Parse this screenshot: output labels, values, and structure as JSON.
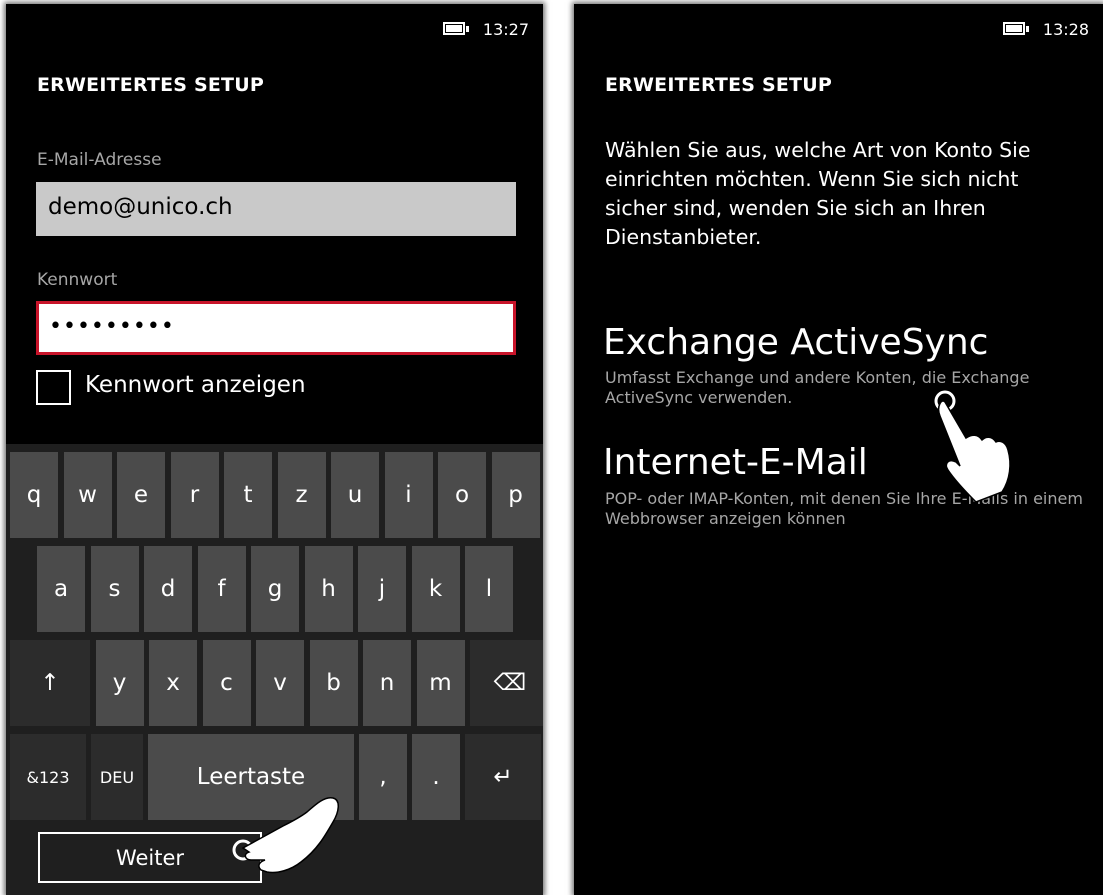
{
  "left": {
    "status": {
      "time": "13:27"
    },
    "title": "ERWEITERTES SETUP",
    "email": {
      "label": "E-Mail-Adresse",
      "value": "demo@unico.ch"
    },
    "password": {
      "label": "Kennwort",
      "value": "•••••••••"
    },
    "show_password": {
      "label": "Kennwort anzeigen",
      "checked": false
    },
    "keyboard": {
      "row1": [
        "q",
        "w",
        "e",
        "r",
        "t",
        "z",
        "u",
        "i",
        "o",
        "p"
      ],
      "row2": [
        "a",
        "s",
        "d",
        "f",
        "g",
        "h",
        "j",
        "k",
        "l"
      ],
      "row3": [
        "↑",
        "y",
        "x",
        "c",
        "v",
        "b",
        "n",
        "m",
        "⌫"
      ],
      "row4": [
        "&123",
        "DEU",
        "Leertaste",
        ",",
        ".",
        "↵"
      ]
    },
    "next_button": "Weiter"
  },
  "right": {
    "status": {
      "time": "13:28"
    },
    "title": "ERWEITERTES SETUP",
    "description": "Wählen Sie aus, welche Art von Konto Sie einrichten möchten. Wenn Sie sich nicht sicher sind, wenden Sie sich an Ihren Dienstanbieter.",
    "options": [
      {
        "title": "Exchange ActiveSync",
        "subtitle": "Umfasst Exchange und andere Konten, die Exchange ActiveSync verwenden."
      },
      {
        "title": "Internet-E-Mail",
        "subtitle": "POP- oder IMAP-Konten, mit denen Sie Ihre E-Mails in einem Webbrowser anzeigen können"
      }
    ]
  },
  "colors": {
    "background": "#000000",
    "accent_error": "#c8142a",
    "key": "#4b4b4b",
    "keyboard": "#1f1f1f"
  },
  "icons": [
    "battery-charging-icon",
    "pointer-hand-icon",
    "backspace-icon",
    "enter-icon",
    "shift-icon"
  ]
}
